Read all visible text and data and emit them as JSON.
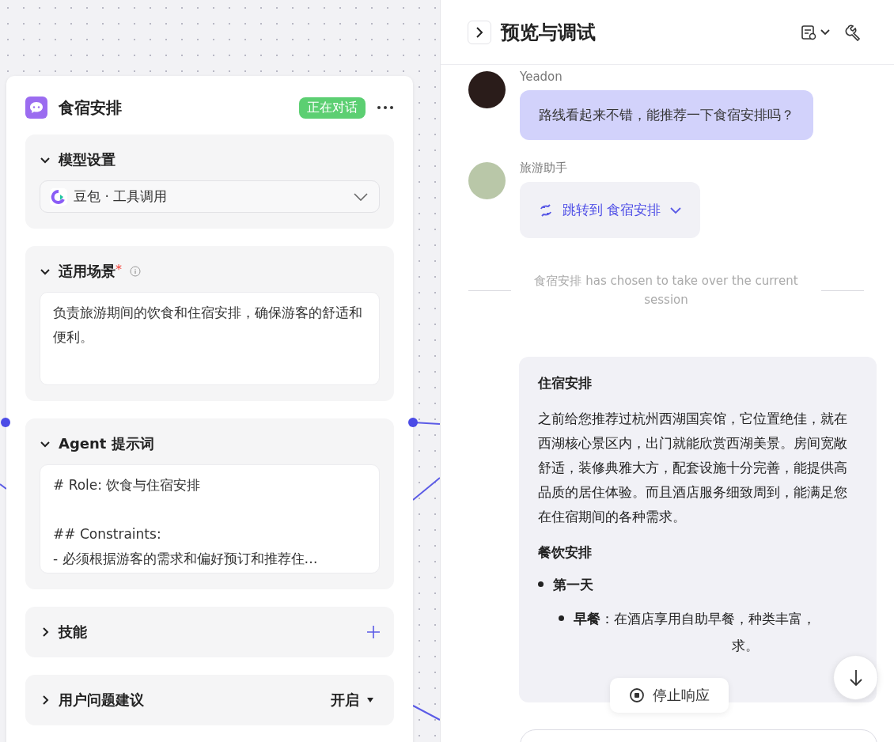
{
  "node": {
    "title": "食宿安排",
    "status": "正在对话",
    "sections": [
      {
        "kind": "model",
        "title": "模型设置",
        "expanded": true,
        "model": "豆包 · 工具调用"
      },
      {
        "kind": "text",
        "title": "适用场景",
        "marker": "*",
        "expanded": true,
        "value": "负责旅游期间的饮食和住宿安排，确保游客的舒适和便利。"
      },
      {
        "kind": "prompt",
        "title": "Agent 提示词",
        "expanded": true,
        "lines": [
          "# Role: 饮食与住宿安排",
          "## Constraints:",
          "- 必须根据游客的需求和偏好预订和推荐住…"
        ]
      },
      {
        "kind": "add",
        "title": "技能",
        "expanded": false
      },
      {
        "kind": "select",
        "title": "用户问题建议",
        "expanded": false,
        "value": "开启"
      }
    ]
  },
  "panel": {
    "title": "预览与调试",
    "messages": [
      {
        "kind": "user",
        "author": "Yeadon",
        "text": "路线看起来不错，能推荐一下食宿安排吗？"
      },
      {
        "kind": "jump",
        "author": "旅游助手",
        "text": "跳转到 食宿安排"
      },
      {
        "kind": "notice",
        "text": "食宿安排 has chosen to take over the current session"
      },
      {
        "kind": "answer",
        "heading1": "住宿安排",
        "paragraph": "之前给您推荐过杭州西湖国宾馆，它位置绝佳，就在西湖核心景区内，出门就能欣赏西湖美景。房间宽敞舒适，装修典雅大方，配套设施十分完善，能提供高品质的居住体验。而且酒店服务细致周到，能满足您在住宿期间的各种需求。",
        "heading2": "餐饮安排",
        "day": "第一天",
        "meal_label": "早餐",
        "meal_text": "：在酒店享用自助早餐，种类丰富，",
        "meal_tail": "求。"
      }
    ],
    "stop_button": "停止响应"
  }
}
